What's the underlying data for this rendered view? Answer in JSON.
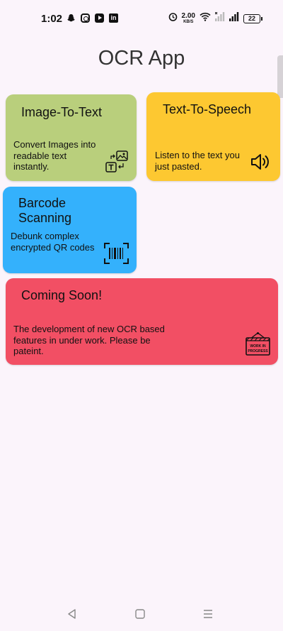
{
  "status_bar": {
    "time": "1:02",
    "net_speed_value": "2.00",
    "net_speed_unit": "KB/S",
    "battery_level": "22",
    "icons": [
      "snapchat-icon",
      "instagram-icon",
      "youtube-icon",
      "linkedin-icon",
      "alarm-icon",
      "wifi-icon",
      "signal-icon",
      "signal-icon",
      "battery-icon"
    ]
  },
  "app": {
    "title": "OCR App"
  },
  "cards": {
    "image_to_text": {
      "title": "Image-To-Text",
      "description": "Convert Images into readable text instantly.",
      "color": "#b9cf7c",
      "icon": "image-to-text-icon"
    },
    "text_to_speech": {
      "title": "Text-To-Speech",
      "description": "Listen to the text you just pasted.",
      "color": "#fdc831",
      "icon": "speaker-icon"
    },
    "barcode": {
      "title": "Barcode Scanning",
      "description": "Debunk complex encrypted QR codes",
      "color": "#34b1fc",
      "icon": "barcode-icon"
    },
    "coming_soon": {
      "title": "Coming Soon!",
      "description": "The development of new OCR based features in under work. Please be pateint.",
      "color": "#f24f64",
      "icon": "work-in-progress-icon",
      "icon_text": "WORK IN PROGRESS"
    }
  },
  "nav_bar": {
    "buttons": [
      "back-icon",
      "home-icon",
      "recents-icon"
    ]
  }
}
